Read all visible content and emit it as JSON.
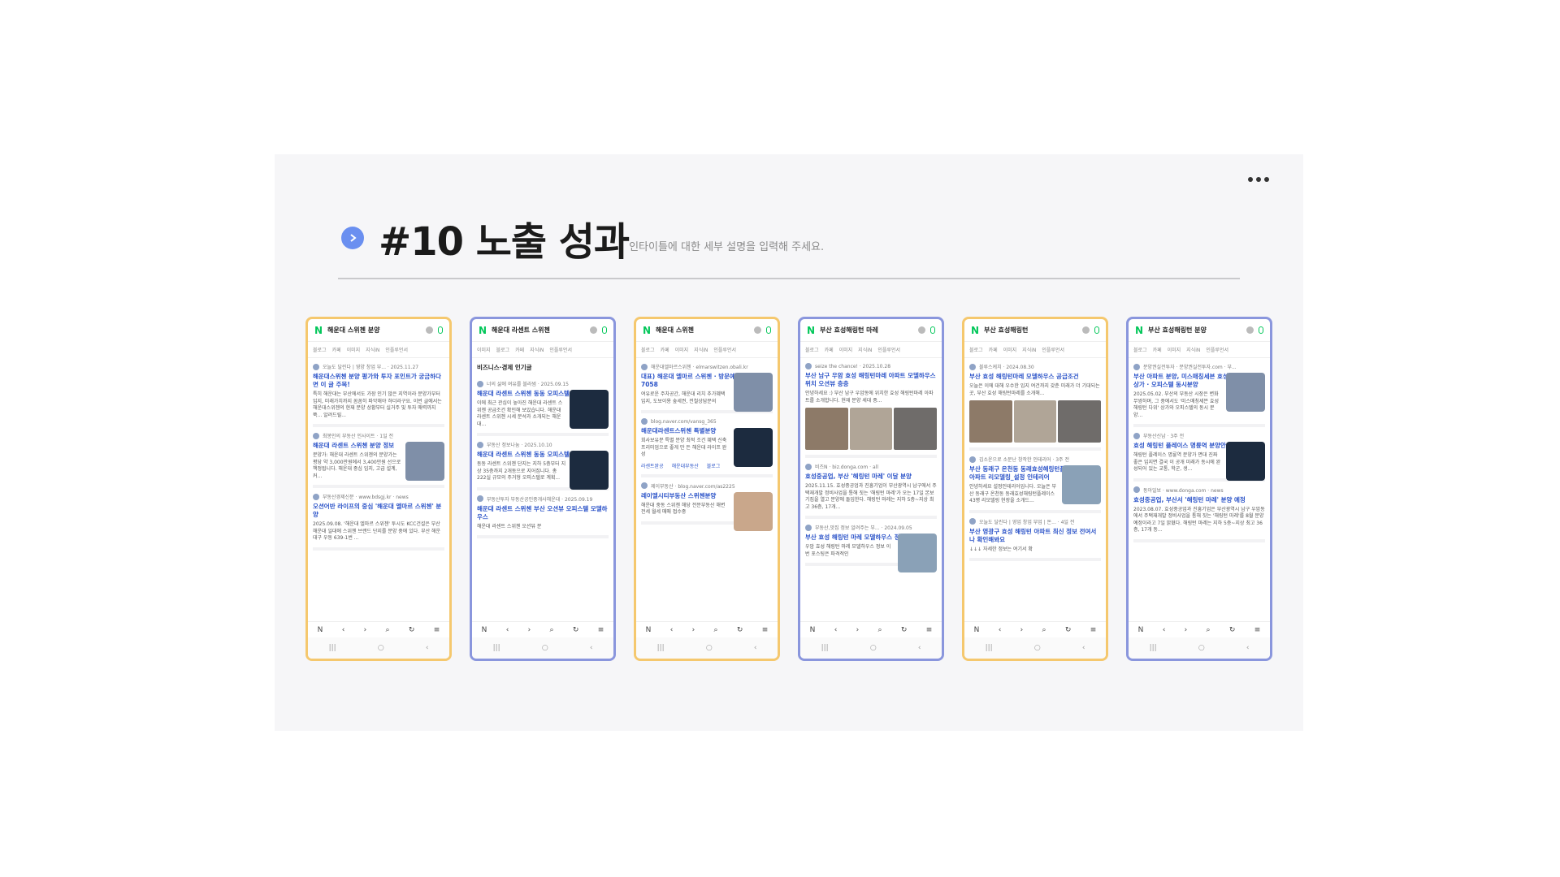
{
  "slide": {
    "title": "#10 노출 성과",
    "subtitle": "인타이틀에 대한 세부 설명을 입력해 주세요.",
    "colors": {
      "bullet": "#6a8ff0",
      "orange_frame": "#f5c86e",
      "blue_frame": "#8a96dd",
      "naver_green": "#03c75a"
    }
  },
  "phones": [
    {
      "frame": "orange",
      "query": "해운대 스위첸 분양",
      "tabs": [
        "블로그",
        "카페",
        "이미지",
        "지식iN",
        "인플루언서"
      ],
      "results": [
        {
          "meta": "오늘도 달린다 | 영양 창업 부... · 2025.11.27",
          "title": "해운대스위첸 분양 평가와 투자 포인트가 궁금하다면 이 글 주목!",
          "snippet": "특히 해운대는 부산에서도 가장 인기 많은 지역이라 분양가부터 입지, 미래가치까지 꼼꼼히 파악해야 하더라구요. 이번 글에서는 해운대스위첸의 현재 분양 상황부터 실거주 및 투자 매력까지 쭉... 알려드릴...",
          "thumb": ""
        },
        {
          "meta": "최봉인의 부동산 인사이트 · 1일 전",
          "title": "해운대 라센트 스위첸 분양 정보",
          "snippet": "분양가: 해운대 라센트 스위첸의 분양가는 평당 약 3,000만원에서 3,400만원 선으로 책정됩니다. 해운대 중심 입지, 고급 설계, 커...",
          "thumb": "bld"
        },
        {
          "meta": "부동산경제신문 · www.bdsgj.kr · news",
          "title": "오션어반 라이프의 중심 '해운대 엘마르 스위첸' 분양",
          "snippet": "2025.09.08. '해운대 엘마르 스위첸' 투시도 KCC건설은 부산 해운대 일대에 스위첸 브랜드 단지를 분양 중에 있다. 부산 해운대구 우동 639-1번 ...",
          "thumb": ""
        }
      ]
    },
    {
      "frame": "blue",
      "query": "해운대 라센트 스위첸",
      "tabs": [
        "이미지",
        "블로그",
        "카페",
        "지식iN",
        "인플루언서"
      ],
      "section": "비즈니스·경제 인기글",
      "results": [
        {
          "meta": "너의 삶에 여유를 블라썸 · 2025.09.15",
          "title": "해운대 라센트 스위첸 동동 오피스텔 공급조건",
          "snippet": "이에 최근 관심이 높아진 해운대 라센트 스위첸 공급조건 확인해 보았습니다. 해운대 라센트 스위첸 시세 분석과 소개되는 해운대...",
          "thumb": "sign"
        },
        {
          "meta": "부동산 정보나눔 · 2025.10.10",
          "title": "해운대 라센트 스위첸 동동 오피스텔 공급조건",
          "snippet": "동동 라센트 스위첸 단지는 지하 5층부터 지상 35층까지 2개동으로 지어집니다. 총 222실 규모의 주거형 오피스텔로 계획...",
          "thumb": "sign"
        },
        {
          "meta": "부동산투자 부동산공인중개사해운대 · 2025.09.19",
          "title": "해운대 라센트 스위첸 부산 오션뷰 오피스텔 모델하우스",
          "snippet": "해운대 라센트 스위첸 오션뷰 분",
          "thumb": ""
        }
      ]
    },
    {
      "frame": "orange",
      "query": "해운대 스위첸",
      "tabs": [
        "블로그",
        "카페",
        "이미지",
        "지식iN",
        "인플루언서"
      ],
      "results": [
        {
          "meta": "해운대엘마르스위첸 · elmarswitzen.obali.kr",
          "title": "대표) 해운대 엘마르 스위첸 · 방문예약 1800-7058",
          "snippet": "여유로운 주차공간, 해운대 리치 추가혜택 입지, 도보이용 숲세권, 전철상담문의",
          "thumb": "bld"
        },
        {
          "meta": "blog.naver.com/vansg_365",
          "title": "해운대라센트스위첸 특별분양",
          "snippet": "회사보유분 특별 분양 최적 조건 혜택 신축 프리미엄으로 좋게 만 든 해운대 라이프 완성",
          "chips": [
            "라센트완공",
            "해운대부동산",
            "블로그"
          ],
          "thumb": "sign"
        },
        {
          "meta": "제이부동산 · blog.naver.com/as2225",
          "title": "레이엘시티부동산 스위첸분양",
          "snippet": "해운대 중동 스위첸 해당 전문부동산 해변 전세 월세 매매 접수중",
          "thumb": "person"
        }
      ]
    },
    {
      "frame": "blue",
      "query": "부산 효성해링턴 마레",
      "tabs": [
        "블로그",
        "카페",
        "이미지",
        "지식iN",
        "인플루언서"
      ],
      "results": [
        {
          "meta": "seize the chance! · 2025.10.28",
          "title": "부산 남구 우암 효성 해링턴마레 아파트 모델하우스 위치 오션뷰 층층",
          "snippet": "안녕하세요 :) 부산 남구 우암동에 위치한 효성 해링턴마레 아파트를 소개합니다. 현재 분양 세대 중...",
          "strip": true
        },
        {
          "meta": "비즈N · biz.donga.com · all",
          "title": "효성중공업, 부산 '해링턴 마레' 이달 분양",
          "snippet": "2025.11.15. 효성중공업과 진흥기업이 부산광역시 남구에서 주택재개발 정비사업을 통해 짓는 '해링턴 마레'가 오는 17일 본보기집을 열고 분양에 돌입한다. 해링턴 마레는 지하 5층~지상 최고 36층, 17개...",
          "thumb": ""
        },
        {
          "meta": "부동산,맛집 정보 알려주는 부... · 2024.09.05",
          "title": "부산 효성 해링턴 마레 모델하우스 정보",
          "snippet": "우암 효성 해링턴 마레 모델하우스 정보 이번 포스팅은 파격적인",
          "thumb": "photo"
        }
      ]
    },
    {
      "frame": "orange",
      "query": "부산 효성해링턴",
      "tabs": [
        "블로그",
        "카페",
        "이미지",
        "지식iN",
        "인플루언서"
      ],
      "results": [
        {
          "meta": "블루스케치 · 2024.08.30",
          "title": "부산 효성 해링턴마레 모델하우스 공급조건",
          "snippet": "오늘은 이에 대해 우수한 입지 여건까지 갖춘 미래가 더 기대되는 곳, 부산 효성 해링턴마레를 소개해...",
          "strip": true
        },
        {
          "meta": "김소운으로 소문난 창작한 인테리어 · 3주 전",
          "title": "부산 동래구 온천동 동래효성해링턴플레이스 43평 아파트 리모델링_설정 인테리어",
          "snippet": "안녕하세요 설정인테리어입니다. 오늘은 부산 동래구 온천동 동래효성해링턴플레이스 43평 리모델링 현장을 소개드...",
          "thumb": "photo"
        },
        {
          "meta": "오늘도 달린다 | 영업 창업 부업 | 돈... · 4일 전",
          "title": "부산 영광구 효성 해링턴 아파트 최신 정보 전여서나 확인해봐요",
          "snippet": "↓↓↓ 자세한 정보는 여기서 확",
          "thumb": ""
        }
      ]
    },
    {
      "frame": "blue",
      "query": "부산 효성해링턴 분양",
      "tabs": [
        "블로그",
        "카페",
        "이미지",
        "지식iN",
        "인플루언서"
      ],
      "results": [
        {
          "meta": "분양권실전투자 · 분양권실전투자.com · 부...",
          "title": "부산 아파트 분양, 미스매칭세븐 효성해링턴 다위 상가 · 오피스텔 동시분양",
          "snippet": "2025.05.02. 부산의 부동산 시장은 변화무쌍하며, 그 중에서도 '미스매칭세븐 효성해링턴 다위' 상가와 오피스텔의 동시 분양...",
          "thumb": "bld"
        },
        {
          "meta": "부동산신남 · 3주 전",
          "title": "효성 해링턴 플레이스 명륜역 분양안내",
          "snippet": "해링턴 플레이스 명륜역 분양가 면대 진짜 좋은 입지면 결국 이 공개 미래가 동시에 완성되어 있는 교통, 학군, 생...",
          "thumb": "sign"
        },
        {
          "meta": "동아일보 · www.donga.com · news",
          "title": "효성중공업, 부산서 '해링턴 마레' 분양 예정",
          "snippet": "2023.08.07. 효성중공업과 진흥기업은 부산광역시 남구 우암동에서 주택재개발 정비사업을 통해 짓는 '해링턴 마레'를 8월 분양 예정이라고 7일 밝혔다. 해링턴 마레는 지하 5층~지상 최고 36층, 17개 동...",
          "thumb": ""
        }
      ]
    }
  ],
  "nav": {
    "bottom_icons": [
      "N",
      "‹",
      "›",
      "⌕",
      "↻",
      "≡"
    ],
    "system_icons": [
      "|||",
      "○",
      "‹"
    ]
  }
}
